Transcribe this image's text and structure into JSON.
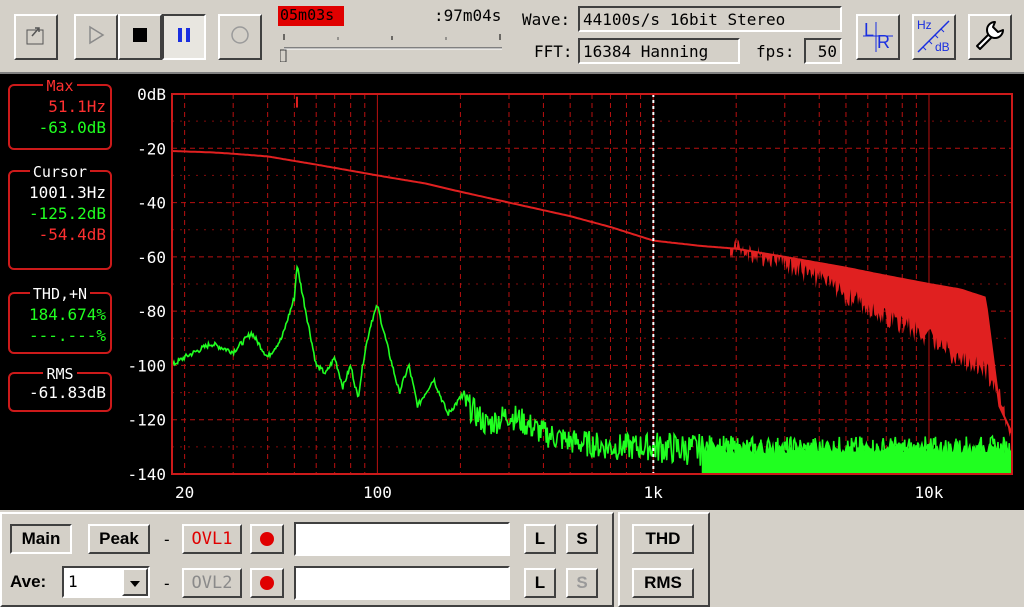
{
  "toolbar": {
    "time_elapsed": "05m03s",
    "time_total": ":97m04s",
    "wave_label": "Wave:",
    "wave_value": "44100s/s 16bit Stereo",
    "fft_label": "FFT:",
    "fft_value": "16384 Hanning",
    "fps_label": "fps:",
    "fps_value": "50",
    "lr_label_l": "L",
    "lr_label_r": "R",
    "hzdb_label_hz": "Hz",
    "hzdb_label_db": "dB",
    "playback_progress": 0.0
  },
  "info": {
    "max_title": "Max",
    "max_freq": "51.1Hz",
    "max_db": "-63.0dB",
    "cursor_title": "Cursor",
    "cursor_freq": "1001.3Hz",
    "cursor_db_green": "-125.2dB",
    "cursor_db_red": "-54.4dB",
    "thd_title": "THD,+N",
    "thd_value": "184.674%",
    "thd_value2": "---.---%",
    "rms_title": "RMS",
    "rms_value": "-61.83dB"
  },
  "bottom": {
    "main_label": "Main",
    "peak_label": "Peak",
    "dash1": "-",
    "ovl1_label": "OVL1",
    "ave_label": "Ave:",
    "ave_value": "1",
    "dash2": "-",
    "ovl2_label": "OVL2",
    "l_label": "L",
    "s_label": "S",
    "thd_button": "THD",
    "rms_button": "RMS"
  },
  "colors": {
    "red_trace": "#e02020",
    "green_trace": "#20ff20",
    "grid": "#b81010",
    "cursor_line": "#ffffff"
  },
  "chart_data": {
    "type": "line",
    "x_scale": "log",
    "xlim": [
      18,
      20000
    ],
    "ylim": [
      -140,
      0
    ],
    "x_ticks": [
      {
        "value": 20,
        "label": "20"
      },
      {
        "value": 100,
        "label": "100"
      },
      {
        "value": 1000,
        "label": "1k"
      },
      {
        "value": 10000,
        "label": "10k"
      }
    ],
    "y_ticks": [
      {
        "value": 0,
        "label": "0dB"
      },
      {
        "value": -20,
        "label": "-20"
      },
      {
        "value": -40,
        "label": "-40"
      },
      {
        "value": -60,
        "label": "-60"
      },
      {
        "value": -80,
        "label": "-80"
      },
      {
        "value": -100,
        "label": "-100"
      },
      {
        "value": -120,
        "label": "-120"
      },
      {
        "value": -140,
        "label": "-140"
      }
    ],
    "cursor_x": 1001.3,
    "series": [
      {
        "color": "#e02020",
        "x": [
          18,
          25,
          30,
          40,
          60,
          100,
          150,
          200,
          300,
          500,
          700,
          1000,
          1500,
          2000,
          3000,
          5000,
          7000,
          10000,
          13000,
          16000,
          18000,
          20000
        ],
        "y": [
          -21,
          -21.5,
          -22,
          -23,
          -26,
          -30,
          -33,
          -36,
          -40,
          -45,
          -49,
          -54,
          -56,
          -57,
          -60,
          -64,
          -67,
          -70,
          -72,
          -75,
          -115,
          -125
        ],
        "floor": [
          -57,
          -62,
          -74,
          -82,
          -90,
          -98,
          -102,
          -110,
          -120,
          -125
        ]
      },
      {
        "color": "#20ff20",
        "x": [
          18,
          20,
          25,
          30,
          35,
          40,
          45,
          50,
          51.1,
          55,
          60,
          65,
          70,
          75,
          80,
          85,
          90,
          95,
          100,
          110,
          120,
          130,
          140,
          160,
          180,
          200,
          250,
          300,
          400,
          500,
          700,
          1000,
          2000,
          5000,
          10000,
          20000
        ],
        "y": [
          -100,
          -97,
          -92,
          -95,
          -88,
          -97,
          -90,
          -75,
          -63,
          -80,
          -100,
          -103,
          -97,
          -108,
          -100,
          -112,
          -95,
          -84,
          -78,
          -95,
          -110,
          -100,
          -115,
          -105,
          -118,
          -112,
          -122,
          -118,
          -125,
          -128,
          -130,
          -130,
          -132,
          -132,
          -132,
          -132
        ]
      }
    ]
  }
}
